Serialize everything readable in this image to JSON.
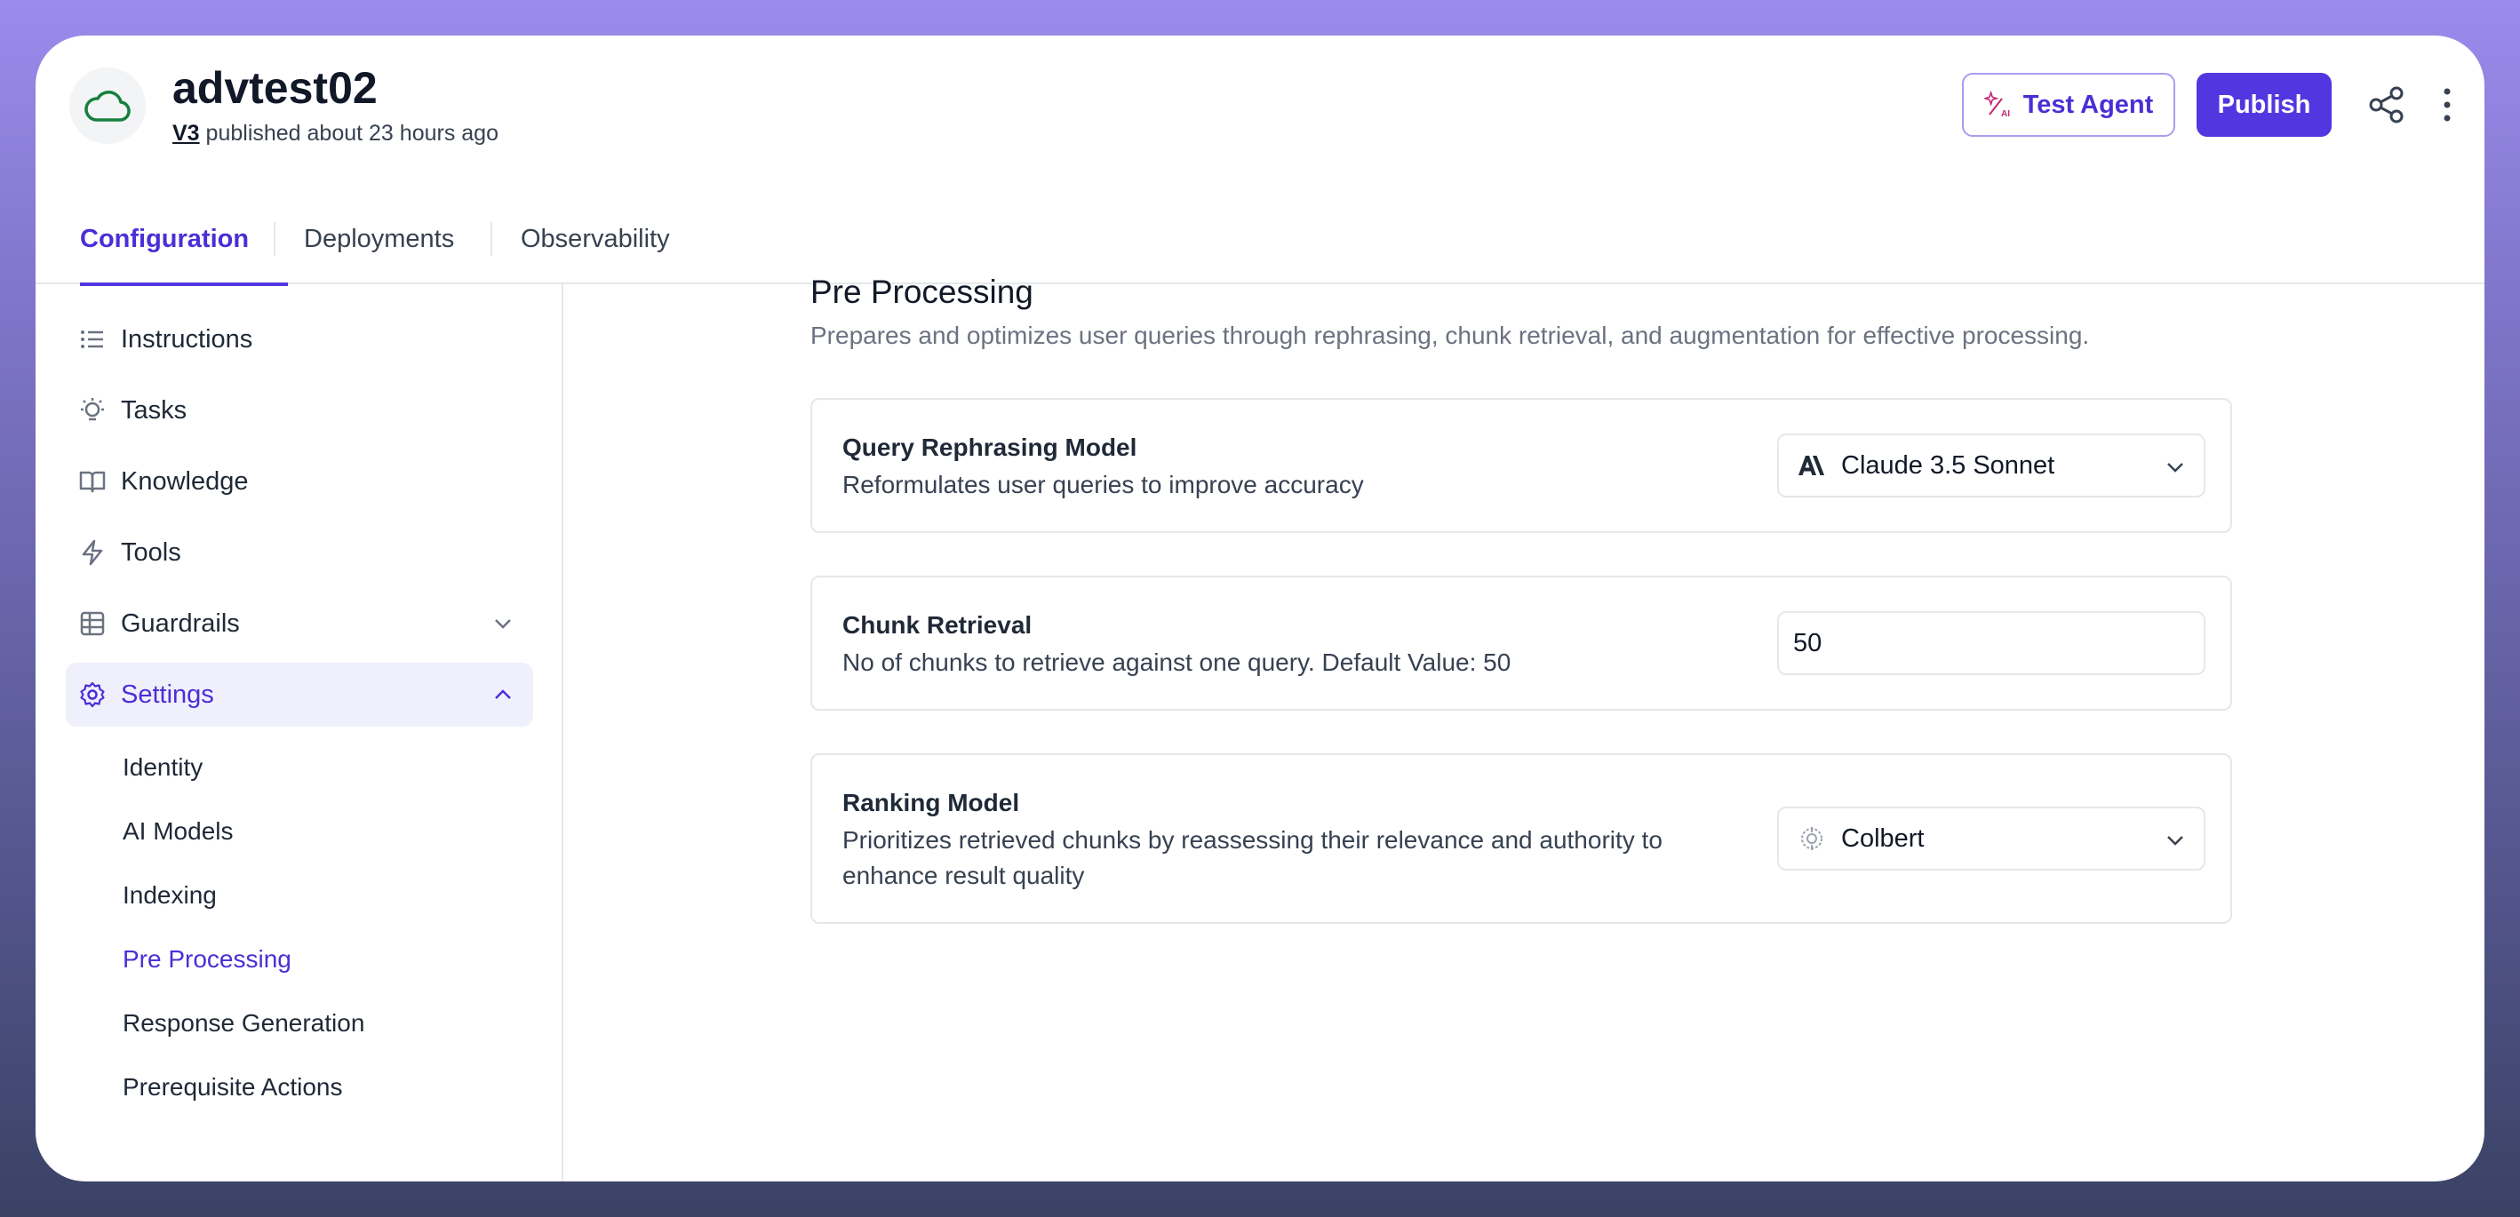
{
  "header": {
    "agent_name": "advtest02",
    "version": "V3",
    "published_text": "published about 23 hours ago",
    "test_agent_label": "Test Agent",
    "publish_label": "Publish"
  },
  "tabs": [
    {
      "label": "Configuration",
      "active": true
    },
    {
      "label": "Deployments",
      "active": false
    },
    {
      "label": "Observability",
      "active": false
    }
  ],
  "sidebar": {
    "items": [
      {
        "label": "Instructions",
        "icon": "list-icon"
      },
      {
        "label": "Tasks",
        "icon": "lightbulb-icon"
      },
      {
        "label": "Knowledge",
        "icon": "book-icon"
      },
      {
        "label": "Tools",
        "icon": "lightning-icon"
      },
      {
        "label": "Guardrails",
        "icon": "grid-icon"
      },
      {
        "label": "Settings",
        "icon": "gear-icon"
      }
    ],
    "settings_sub": [
      {
        "label": "Identity"
      },
      {
        "label": "AI Models"
      },
      {
        "label": "Indexing"
      },
      {
        "label": "Pre Processing"
      },
      {
        "label": "Response Generation"
      },
      {
        "label": "Prerequisite Actions"
      }
    ]
  },
  "main": {
    "title": "Pre Processing",
    "description": "Prepares and optimizes user queries through rephrasing, chunk retrieval, and augmentation for effective processing.",
    "cards": [
      {
        "title": "Query Rephrasing Model",
        "description": "Reformulates user queries to improve accuracy",
        "value": "Claude 3.5 Sonnet",
        "icon": "anthropic-icon"
      },
      {
        "title": "Chunk Retrieval",
        "description": "No of chunks to retrieve against one query. Default Value: 50",
        "value": "50"
      },
      {
        "title": "Ranking Model",
        "description": "Prioritizes retrieved chunks by reassessing their relevance and authority to enhance result quality",
        "value": "Colbert",
        "icon": "colbert-icon"
      }
    ]
  },
  "colors": {
    "accent": "#5236e0",
    "accent_text": "#4a2fd6",
    "active_bg": "#f0effc"
  }
}
